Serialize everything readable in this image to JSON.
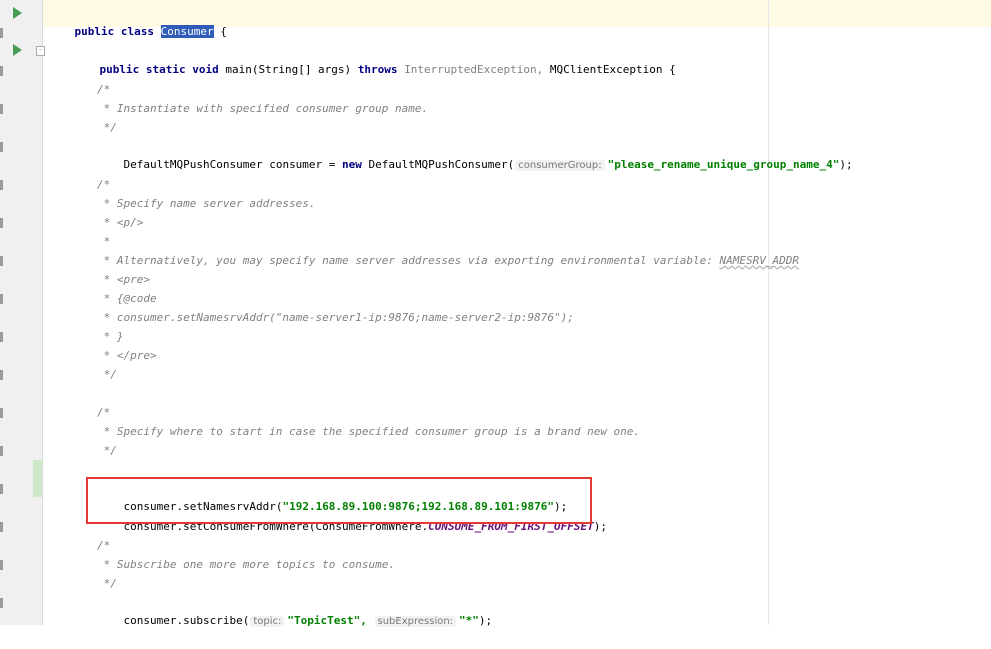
{
  "class_line": {
    "public": "public",
    "class": "class",
    "name": "Consumer",
    "brace": "{"
  },
  "main_line": {
    "mods": "public static void",
    "sig": "main(String[] args)",
    "throws": "throws",
    "ex1": "InterruptedException,",
    "ex2": "MQClientException {"
  },
  "comment1": [
    "/*",
    " * Instantiate with specified consumer group name.",
    " */"
  ],
  "decl": {
    "type": "DefaultMQPushConsumer consumer =",
    "new": "new",
    "ctor": "DefaultMQPushConsumer(",
    "hint": "consumerGroup:",
    "arg": "\"please_rename_unique_group_name_4\"",
    "end": ");"
  },
  "comment2": [
    "/*",
    " * Specify name server addresses.",
    " * <p/>",
    " *",
    " * Alternatively, you may specify name server addresses via exporting environmental variable: ",
    " * <pre>",
    " * {@code",
    " * consumer.setNamesrvAddr(\"name-server1-ip:9876;name-server2-ip:9876\");",
    " * }",
    " * </pre>",
    " */"
  ],
  "env_var": "NAMESRV_ADDR",
  "comment3": [
    "/*",
    " * Specify where to start in case the specified consumer group is a brand new one.",
    " */"
  ],
  "set_addr": {
    "call": "consumer.setNamesrvAddr(",
    "arg": "\"192.168.89.100:9876;192.168.89.101:9876\"",
    "end": ");"
  },
  "set_from": {
    "call": "consumer.setConsumeFromWhere(ConsumeFromWhere.",
    "const": "CONSUME_FROM_FIRST_OFFSET",
    "end": ");"
  },
  "comment4": [
    "/*",
    " * Subscribe one more more topics to consume.",
    " */"
  ],
  "subscribe": {
    "call": "consumer.subscribe(",
    "hint1": "topic:",
    "arg1": "\"TopicTest\",",
    "hint2": "subExpression:",
    "arg2": "\"*\"",
    "end": ");"
  }
}
